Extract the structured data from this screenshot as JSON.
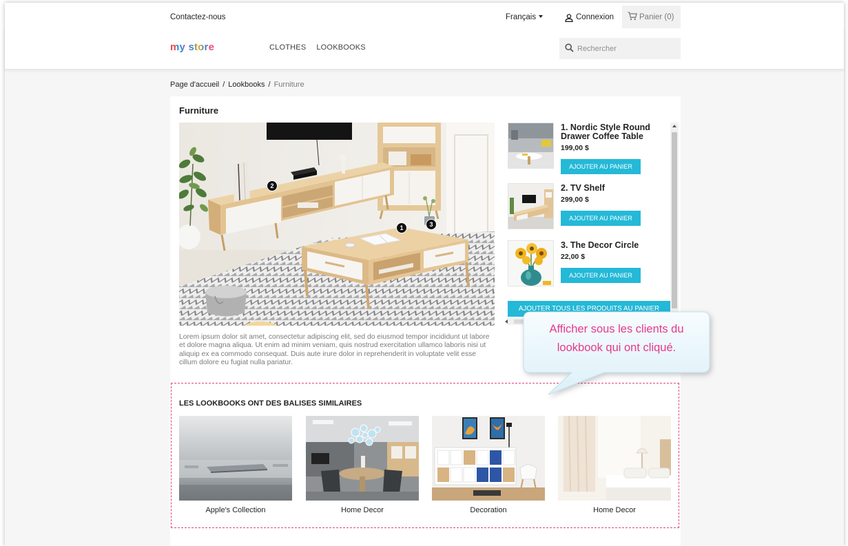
{
  "topbar": {
    "contact": "Contactez-nous",
    "language": "Français",
    "login": "Connexion",
    "cart": "Panier (0)"
  },
  "header": {
    "logo": "my store",
    "nav": [
      "CLOTHES",
      "LOOKBOOKS"
    ],
    "search_placeholder": "Rechercher"
  },
  "breadcrumb": {
    "items": [
      "Page d'accueil",
      "Lookbooks",
      "Furniture"
    ],
    "separator": "/"
  },
  "lookbook": {
    "title": "Furniture",
    "hotspots": [
      "1",
      "2",
      "3"
    ],
    "products": [
      {
        "name": "1. Nordic Style Round Drawer Coffee Table",
        "price": "199,00 $",
        "button": "AJOUTER AU PANIER"
      },
      {
        "name": "2. TV Shelf",
        "price": "299,00 $",
        "button": "AJOUTER AU PANIER"
      },
      {
        "name": "3. The Decor Circle",
        "price": "22,00 $",
        "button": "AJOUTER AU PANIER"
      }
    ],
    "add_all_label": "AJOUTER TOUS LES PRODUITS AU PANIER",
    "description": "Lorem ipsum dolor sit amet, consectetur adipiscing elit, sed do eiusmod tempor incididunt ut labore et dolore magna aliqua. Ut enim ad minim veniam, quis nostrud exercitation ullamco laboris nisi ut aliquip ex ea commodo consequat. Duis aute irure dolor in reprehenderit in voluptate velit esse cillum dolore eu fugiat nulla pariatur."
  },
  "callout": {
    "line1": "Afficher sous les clients du",
    "line2": "lookbook qui ont cliqué."
  },
  "related": {
    "heading": "LES LOOKBOOKS ONT DES BALISES SIMILAIRES",
    "items": [
      {
        "label": "Apple's Collection"
      },
      {
        "label": "Home Decor"
      },
      {
        "label": "Decoration"
      },
      {
        "label": "Home Decor"
      }
    ]
  },
  "icons": {
    "login": "user-icon",
    "cart": "cart-icon",
    "search": "search-icon"
  },
  "colors": {
    "accent": "#24b9d7",
    "callout_text": "#e8388a",
    "highlight_border": "#e0447e"
  }
}
